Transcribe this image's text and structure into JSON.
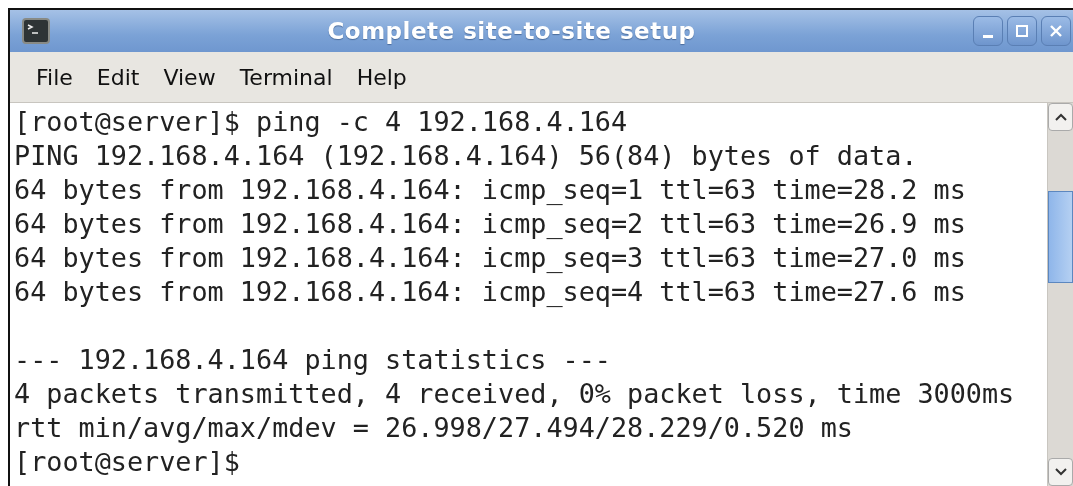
{
  "window": {
    "title": "Complete site-to-site setup"
  },
  "menu": [
    "File",
    "Edit",
    "View",
    "Terminal",
    "Help"
  ],
  "terminal": {
    "blocks": [
      [
        "[root@server]$ ping -c 4 192.168.4.164",
        "PING 192.168.4.164 (192.168.4.164) 56(84) bytes of data.",
        "64 bytes from 192.168.4.164: icmp_seq=1 ttl=63 time=28.2 ms",
        "64 bytes from 192.168.4.164: icmp_seq=2 ttl=63 time=26.9 ms",
        "64 bytes from 192.168.4.164: icmp_seq=3 ttl=63 time=27.0 ms",
        "64 bytes from 192.168.4.164: icmp_seq=4 ttl=63 time=27.6 ms"
      ],
      [
        "--- 192.168.4.164 ping statistics ---",
        "4 packets transmitted, 4 received, 0% packet loss, time 3000ms",
        "rtt min/avg/max/mdev = 26.998/27.494/28.229/0.520 ms",
        "[root@server]$"
      ]
    ]
  }
}
